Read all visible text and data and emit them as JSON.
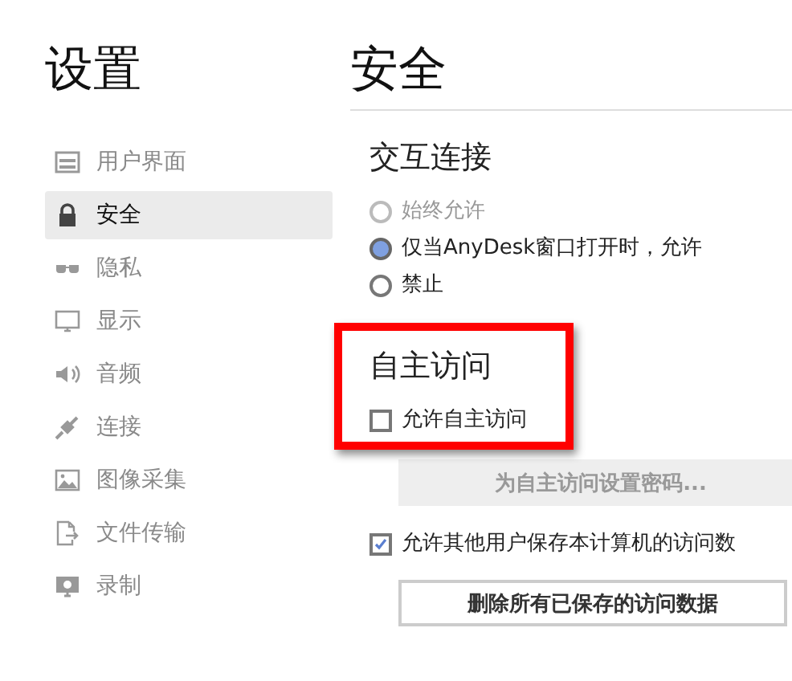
{
  "sidebar": {
    "title": "设置",
    "items": [
      {
        "label": "用户界面",
        "selected": false
      },
      {
        "label": "安全",
        "selected": true
      },
      {
        "label": "隐私",
        "selected": false
      },
      {
        "label": "显示",
        "selected": false
      },
      {
        "label": "音频",
        "selected": false
      },
      {
        "label": "连接",
        "selected": false
      },
      {
        "label": "图像采集",
        "selected": false
      },
      {
        "label": "文件传输",
        "selected": false
      },
      {
        "label": "录制",
        "selected": false
      }
    ]
  },
  "page": {
    "title": "安全",
    "interactive": {
      "title": "交互连接",
      "options": [
        {
          "label": "始终允许",
          "selected": false,
          "disabled": true
        },
        {
          "label": "仅当AnyDesk窗口打开时，允许",
          "selected": true,
          "disabled": false
        },
        {
          "label": "禁止",
          "selected": false,
          "disabled": false
        }
      ]
    },
    "unattended": {
      "title": "自主访问",
      "highlighted": true,
      "checkbox": {
        "label": "允许自主访问",
        "checked": false
      },
      "password_button": {
        "label": "为自主访问设置密码...",
        "disabled": true
      }
    },
    "save_checkbox": {
      "label": "允许其他用户保存本计算机的访问数",
      "checked": true
    },
    "delete_button": {
      "label": "删除所有已保存的访问数据",
      "disabled": false
    }
  }
}
